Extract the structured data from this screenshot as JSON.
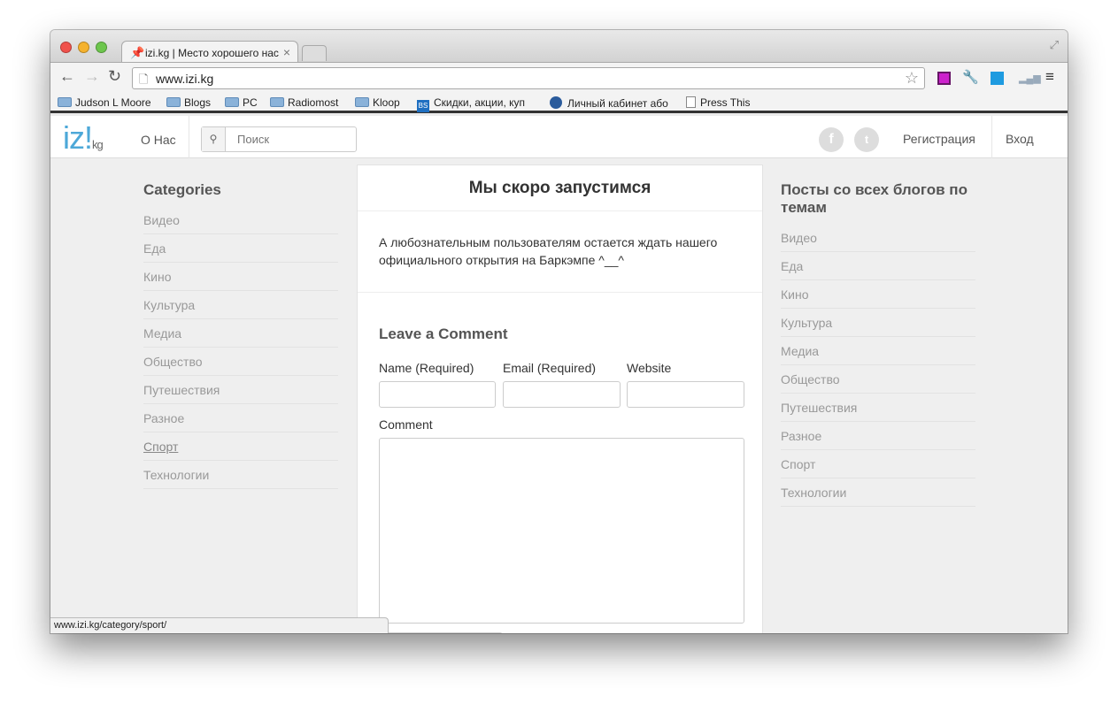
{
  "browser": {
    "tab_title": "izi.kg | Место хорошего нас",
    "tab_close": "×",
    "url": "www.izi.kg",
    "bookmarks": [
      "Judson L Moore",
      "Blogs",
      "PC",
      "Radiomost",
      "Kloop",
      "Скидки, акции, куп",
      "Личный кабинет або",
      "Press This"
    ],
    "bookmark_bs_label": "BS",
    "status_url": "www.izi.kg/category/sport/"
  },
  "header": {
    "logo_main": "iz!",
    "logo_sub": "kg",
    "about": "О Нас",
    "search_placeholder": "Поиск",
    "register": "Регистрация",
    "login": "Вход"
  },
  "left_sidebar": {
    "title": "Categories",
    "items": [
      "Видео",
      "Еда",
      "Кино",
      "Культура",
      "Медиа",
      "Общество",
      "Путешествия",
      "Разное",
      "Спорт",
      "Технологии"
    ]
  },
  "right_sidebar": {
    "title": "Посты со всех блогов по темам",
    "items": [
      "Видео",
      "Еда",
      "Кино",
      "Культура",
      "Медиа",
      "Общество",
      "Путешествия",
      "Разное",
      "Спорт",
      "Технологии"
    ]
  },
  "post": {
    "title": "Мы скоро запустимся",
    "body": "А любознательным пользователям остается ждать нашего официального открытия на Баркэмпе ^__^"
  },
  "comment_form": {
    "heading": "Leave a Comment",
    "name_label": "Name (Required)",
    "email_label": "Email (Required)",
    "website_label": "Website",
    "comment_label": "Comment"
  }
}
